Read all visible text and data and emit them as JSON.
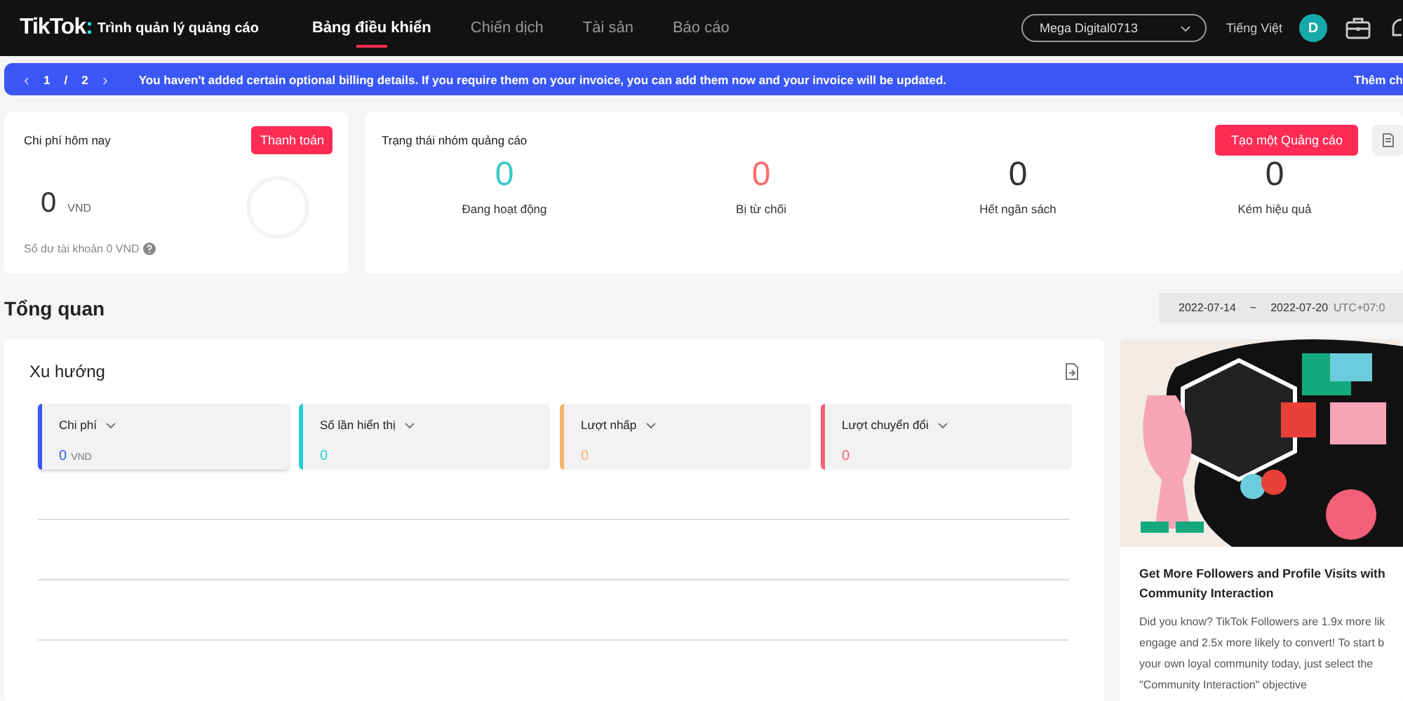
{
  "header": {
    "logo": "TikTok",
    "logo_dot": ":",
    "product": "Trình quản lý quảng cáo",
    "nav": [
      {
        "label": "Bảng điều khiển",
        "selected": true
      },
      {
        "label": "Chiến dịch",
        "selected": false
      },
      {
        "label": "Tài sản",
        "selected": false
      },
      {
        "label": "Báo cáo",
        "selected": false
      }
    ],
    "account": "Mega Digital0713",
    "language": "Tiếng Việt",
    "avatar": "D"
  },
  "banner": {
    "prev": "‹",
    "page": "1",
    "sep": "/",
    "total": "2",
    "next": "›",
    "message": "You haven't added certain optional billing details. If you require them on your invoice, you can add them now and your invoice will be updated.",
    "action": "Thêm ch"
  },
  "spend_card": {
    "title": "Chi phí hôm nay",
    "button": "Thanh toán",
    "amount": "0",
    "currency": "VND",
    "balance": "Số dư tài khoản 0 VND"
  },
  "status_card": {
    "title": "Trạng thái nhóm quảng cáo",
    "button": "Tạo một Quảng cáo",
    "stats": [
      {
        "value": "0",
        "label": "Đang hoạt động",
        "color": "#3cc8c8"
      },
      {
        "value": "0",
        "label": "Bị từ chối",
        "color": "#fe6b6b"
      },
      {
        "value": "0",
        "label": "Hết ngân sách",
        "color": "#333333"
      },
      {
        "value": "0",
        "label": "Kém hiệu quả",
        "color": "#333333"
      }
    ]
  },
  "overview": {
    "title": "Tổng quan",
    "date_start": "2022-07-14",
    "date_sep": "~",
    "date_end": "2022-07-20",
    "timezone": "UTC+07:0"
  },
  "trend": {
    "title": "Xu hướng",
    "metrics": [
      {
        "label": "Chi phí",
        "value": "0",
        "unit": "VND",
        "color": "#3a56f5",
        "selected": true
      },
      {
        "label": "Số lần hiển thị",
        "value": "0",
        "color": "#25d0d8",
        "selected": false
      },
      {
        "label": "Lượt nhấp",
        "value": "0",
        "color": "#f9b36b",
        "selected": false
      },
      {
        "label": "Lượt chuyển đổi",
        "value": "0",
        "color": "#f2607a",
        "selected": false
      }
    ]
  },
  "promo": {
    "title": "Get More Followers and Profile Visits with Community Interaction",
    "body": [
      "Did you know? TikTok Followers are 1.9x more lik",
      "engage and 2.5x more likely to convert! To start b",
      "your own loyal community today, just select the",
      "\"Community Interaction\" objective"
    ]
  }
}
